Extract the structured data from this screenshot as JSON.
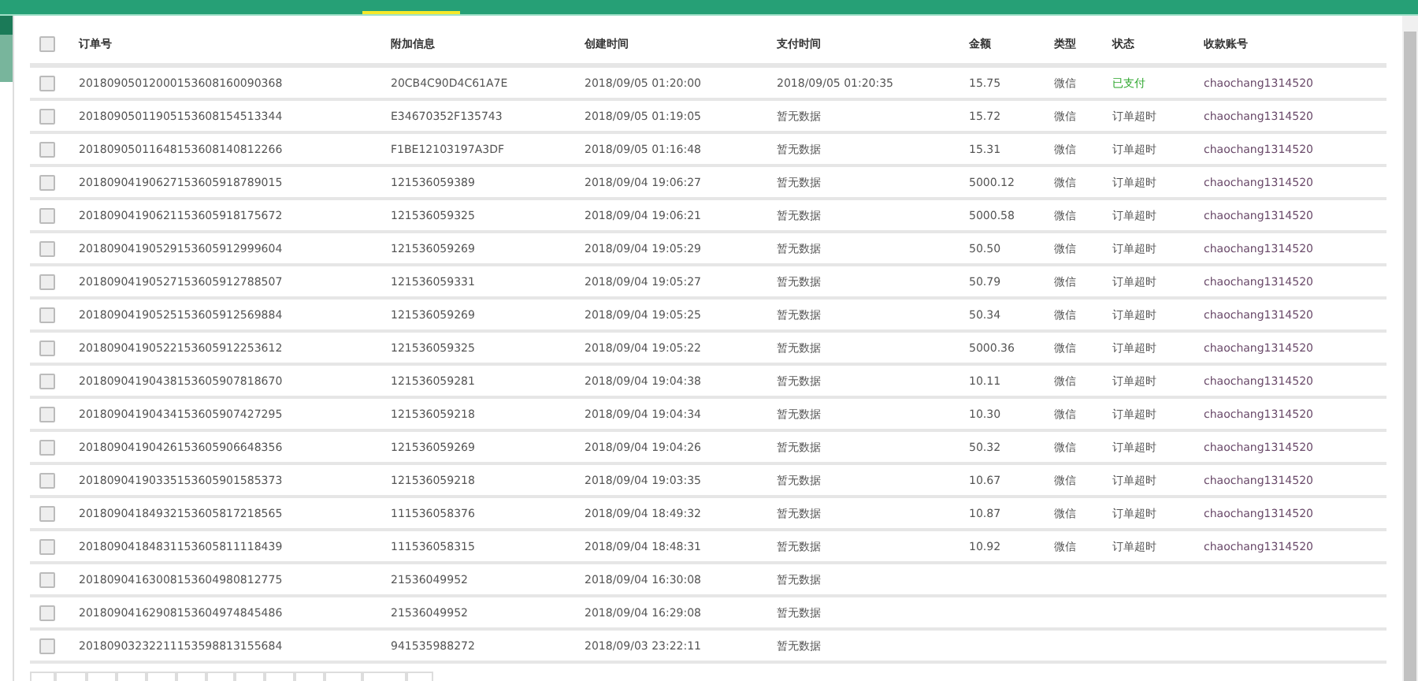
{
  "header_checkbox": {
    "checked": false
  },
  "table": {
    "columns": [
      "订单号",
      "附加信息",
      "创建时间",
      "支付时间",
      "金额",
      "类型",
      "状态",
      "收款账号"
    ],
    "rows": [
      {
        "checked": false,
        "order": "20180905012000153608160090368",
        "info": "20CB4C90D4C61A7E",
        "created": "2018/09/05 01:20:00",
        "paid_time": "2018/09/05 01:20:35",
        "amount": "15.75",
        "type": "微信",
        "status": {
          "text": "已支付",
          "paid": true
        },
        "account": "chaochang1314520"
      },
      {
        "checked": false,
        "order": "20180905011905153608154513344",
        "info": "E34670352F135743",
        "created": "2018/09/05 01:19:05",
        "paid_time": "暂无数据",
        "amount": "15.72",
        "type": "微信",
        "status": {
          "text": "订单超时",
          "paid": false
        },
        "account": "chaochang1314520"
      },
      {
        "checked": false,
        "order": "20180905011648153608140812266",
        "info": "F1BE12103197A3DF",
        "created": "2018/09/05 01:16:48",
        "paid_time": "暂无数据",
        "amount": "15.31",
        "type": "微信",
        "status": {
          "text": "订单超时",
          "paid": false
        },
        "account": "chaochang1314520"
      },
      {
        "checked": false,
        "order": "20180904190627153605918789015",
        "info": "121536059389",
        "created": "2018/09/04 19:06:27",
        "paid_time": "暂无数据",
        "amount": "5000.12",
        "type": "微信",
        "status": {
          "text": "订单超时",
          "paid": false
        },
        "account": "chaochang1314520"
      },
      {
        "checked": false,
        "order": "20180904190621153605918175672",
        "info": "121536059325",
        "created": "2018/09/04 19:06:21",
        "paid_time": "暂无数据",
        "amount": "5000.58",
        "type": "微信",
        "status": {
          "text": "订单超时",
          "paid": false
        },
        "account": "chaochang1314520"
      },
      {
        "checked": false,
        "order": "20180904190529153605912999604",
        "info": "121536059269",
        "created": "2018/09/04 19:05:29",
        "paid_time": "暂无数据",
        "amount": "50.50",
        "type": "微信",
        "status": {
          "text": "订单超时",
          "paid": false
        },
        "account": "chaochang1314520"
      },
      {
        "checked": false,
        "order": "20180904190527153605912788507",
        "info": "121536059331",
        "created": "2018/09/04 19:05:27",
        "paid_time": "暂无数据",
        "amount": "50.79",
        "type": "微信",
        "status": {
          "text": "订单超时",
          "paid": false
        },
        "account": "chaochang1314520"
      },
      {
        "checked": false,
        "order": "20180904190525153605912569884",
        "info": "121536059269",
        "created": "2018/09/04 19:05:25",
        "paid_time": "暂无数据",
        "amount": "50.34",
        "type": "微信",
        "status": {
          "text": "订单超时",
          "paid": false
        },
        "account": "chaochang1314520"
      },
      {
        "checked": false,
        "order": "20180904190522153605912253612",
        "info": "121536059325",
        "created": "2018/09/04 19:05:22",
        "paid_time": "暂无数据",
        "amount": "5000.36",
        "type": "微信",
        "status": {
          "text": "订单超时",
          "paid": false
        },
        "account": "chaochang1314520"
      },
      {
        "checked": false,
        "order": "20180904190438153605907818670",
        "info": "121536059281",
        "created": "2018/09/04 19:04:38",
        "paid_time": "暂无数据",
        "amount": "10.11",
        "type": "微信",
        "status": {
          "text": "订单超时",
          "paid": false
        },
        "account": "chaochang1314520"
      },
      {
        "checked": false,
        "order": "20180904190434153605907427295",
        "info": "121536059218",
        "created": "2018/09/04 19:04:34",
        "paid_time": "暂无数据",
        "amount": "10.30",
        "type": "微信",
        "status": {
          "text": "订单超时",
          "paid": false
        },
        "account": "chaochang1314520"
      },
      {
        "checked": false,
        "order": "20180904190426153605906648356",
        "info": "121536059269",
        "created": "2018/09/04 19:04:26",
        "paid_time": "暂无数据",
        "amount": "50.32",
        "type": "微信",
        "status": {
          "text": "订单超时",
          "paid": false
        },
        "account": "chaochang1314520"
      },
      {
        "checked": false,
        "order": "20180904190335153605901585373",
        "info": "121536059218",
        "created": "2018/09/04 19:03:35",
        "paid_time": "暂无数据",
        "amount": "10.67",
        "type": "微信",
        "status": {
          "text": "订单超时",
          "paid": false
        },
        "account": "chaochang1314520"
      },
      {
        "checked": false,
        "order": "20180904184932153605817218565",
        "info": "111536058376",
        "created": "2018/09/04 18:49:32",
        "paid_time": "暂无数据",
        "amount": "10.87",
        "type": "微信",
        "status": {
          "text": "订单超时",
          "paid": false
        },
        "account": "chaochang1314520"
      },
      {
        "checked": false,
        "order": "20180904184831153605811118439",
        "info": "111536058315",
        "created": "2018/09/04 18:48:31",
        "paid_time": "暂无数据",
        "amount": "10.92",
        "type": "微信",
        "status": {
          "text": "订单超时",
          "paid": false
        },
        "account": "chaochang1314520"
      },
      {
        "checked": false,
        "order": "20180904163008153604980812775",
        "info": "21536049952",
        "created": "2018/09/04 16:30:08",
        "paid_time": "暂无数据"
      },
      {
        "checked": false,
        "order": "20180904162908153604974845486",
        "info": "21536049952",
        "created": "2018/09/04 16:29:08",
        "paid_time": "暂无数据"
      },
      {
        "checked": false,
        "order": "20180903232211153598813155684",
        "info": "941535988272",
        "created": "2018/09/03 23:22:11",
        "paid_time": "暂无数据"
      }
    ]
  }
}
